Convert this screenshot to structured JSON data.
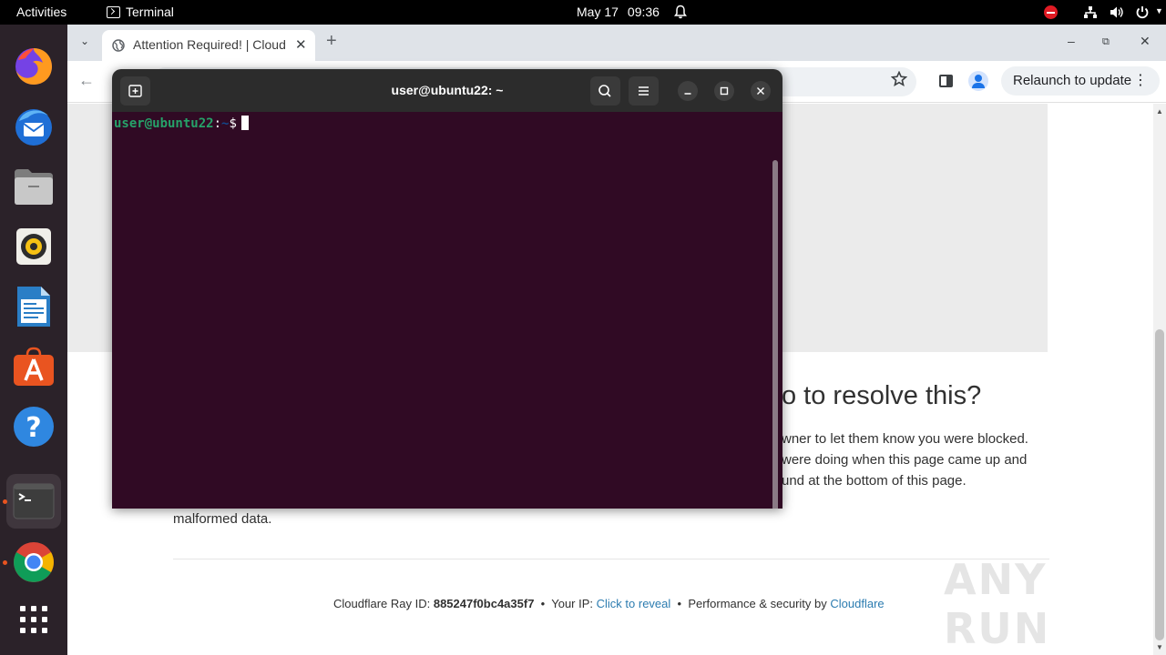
{
  "topbar": {
    "activities": "Activities",
    "app_name": "Terminal",
    "date": "May 17",
    "time": "09:36"
  },
  "dock": {
    "apps": [
      "firefox",
      "thunderbird",
      "files",
      "rhythmbox",
      "libreoffice-writer",
      "app-center",
      "help",
      "terminal",
      "chrome",
      "show-apps"
    ]
  },
  "browser": {
    "tab_title": "Attention Required! | Cloudflare",
    "relaunch_label": "Relaunch to update",
    "page": {
      "heading": "o to resolve this?",
      "text_lines": [
        "wner to let them know you were blocked.",
        "were doing when this page came up and",
        "und at the bottom of this page."
      ],
      "malformed": "malformed data.",
      "footer": {
        "ray_label": "Cloudflare Ray ID:",
        "ray_id": "885247f0bc4a35f7",
        "bullet": "•",
        "ip_label": "Your IP:",
        "ip_link": "Click to reveal",
        "perf_label": "Performance & security by",
        "perf_link": "Cloudflare"
      }
    },
    "watermark": "ANY RUN"
  },
  "terminal": {
    "title": "user@ubuntu22: ~",
    "prompt_user": "user@ubuntu22",
    "prompt_sep": ":",
    "prompt_path": "~",
    "prompt_symbol": "$"
  },
  "colors": {
    "terminal_bg": "#300a24",
    "prompt_green": "#26a269",
    "prompt_blue": "#12488b",
    "ubuntu_orange": "#e95420",
    "link": "#2c7cb0"
  }
}
